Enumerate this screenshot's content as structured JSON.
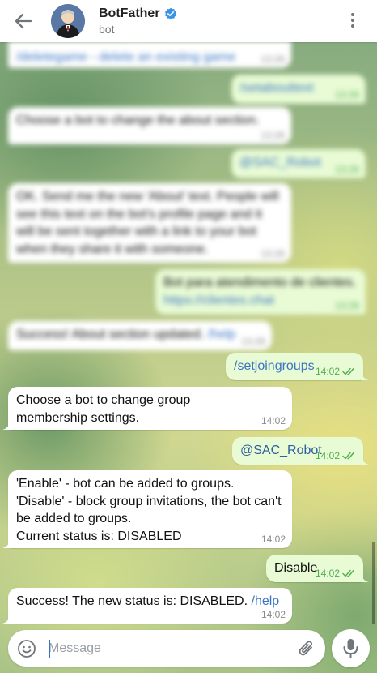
{
  "header": {
    "title": "BotFather",
    "subtitle": "bot",
    "verified_icon": "verified-badge-icon",
    "back_icon": "arrow-left-icon",
    "menu_icon": "more-vertical-icon"
  },
  "colors": {
    "link": "#3b76c4",
    "outgoing_bubble": "#e8fbd5",
    "incoming_bubble": "#ffffff",
    "read_check": "#4fae4e"
  },
  "blurred_messages": [
    {
      "dir": "in",
      "text": "/deletegame - delete an existing game",
      "time": "13:26"
    },
    {
      "dir": "out",
      "text": "/setabouttext",
      "time": "13:26"
    },
    {
      "dir": "in",
      "text": "Choose a bot to change the about section.",
      "time": "13:26"
    },
    {
      "dir": "out",
      "text": "@SAC_Robot",
      "time": "13:26"
    },
    {
      "dir": "in",
      "text": "OK. Send me the new 'About' text. People will see this text on the bot's profile page and it will be sent together with a link to your bot when they share it with someone.",
      "time": "13:26"
    },
    {
      "dir": "out",
      "text": "Bot para atendimento de clientes.",
      "link": "https://clientes.chat",
      "time": "13:26"
    },
    {
      "dir": "in",
      "text": "Success! About section updated.",
      "link": "/help",
      "time": "13:26"
    }
  ],
  "messages": [
    {
      "dir": "out",
      "text": "/setjoingroups",
      "time": "14:02"
    },
    {
      "dir": "in",
      "text": "Choose a bot to change group membership settings.",
      "time": "14:02"
    },
    {
      "dir": "out",
      "text": "@SAC_Robot",
      "time": "14:02"
    },
    {
      "dir": "in",
      "text": "'Enable' - bot can be added to groups.\n'Disable' - block group invitations, the bot can't be added to groups.\nCurrent status is: DISABLED",
      "time": "14:02"
    },
    {
      "dir": "out",
      "text": "Disable",
      "time": "14:02"
    },
    {
      "dir": "in",
      "text": "Success! The new status is: DISABLED.",
      "link": "/help",
      "time": "14:02"
    }
  ],
  "composer": {
    "placeholder": "Message",
    "emoji_icon": "smile-icon",
    "attach_icon": "paperclip-icon",
    "mic_icon": "microphone-icon"
  }
}
